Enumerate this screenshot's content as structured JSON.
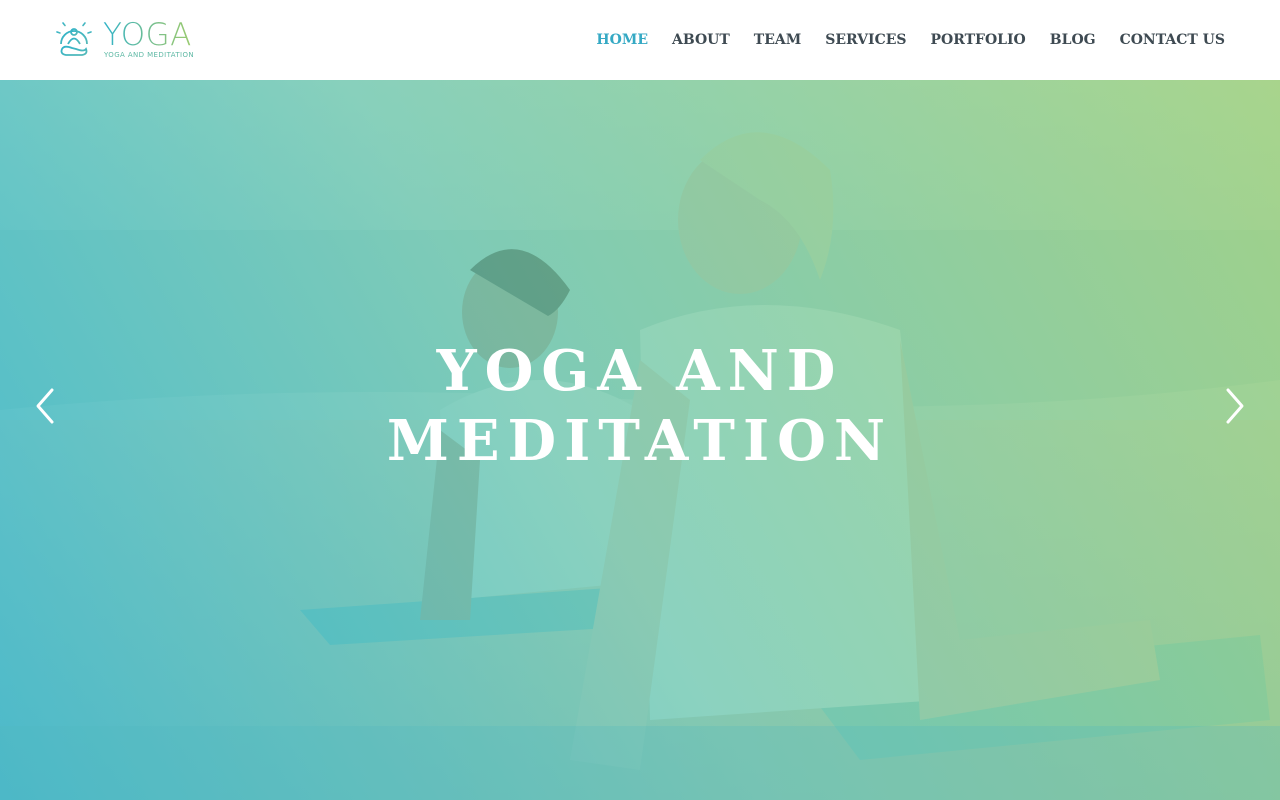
{
  "brand": {
    "name": "YOGA",
    "tagline": "YOGA AND MEDITATION",
    "icon": "meditation-logo-icon",
    "colors": {
      "gradient_start": "#2fb3c9",
      "gradient_end": "#9acb6f"
    }
  },
  "nav": {
    "items": [
      {
        "label": "HOME",
        "active": true
      },
      {
        "label": "ABOUT",
        "active": false
      },
      {
        "label": "TEAM",
        "active": false
      },
      {
        "label": "SERVICES",
        "active": false
      },
      {
        "label": "PORTFOLIO",
        "active": false
      },
      {
        "label": "BLOG",
        "active": false
      },
      {
        "label": "CONTACT US",
        "active": false
      }
    ],
    "colors": {
      "active": "#35a9c4",
      "default": "#3e4a52"
    }
  },
  "hero": {
    "title_line1": "YOGA AND",
    "title_line2": "MEDITATION",
    "image": "couple-yoga-on-beach-photo",
    "prev_icon": "chevron-left-icon",
    "next_icon": "chevron-right-icon"
  }
}
